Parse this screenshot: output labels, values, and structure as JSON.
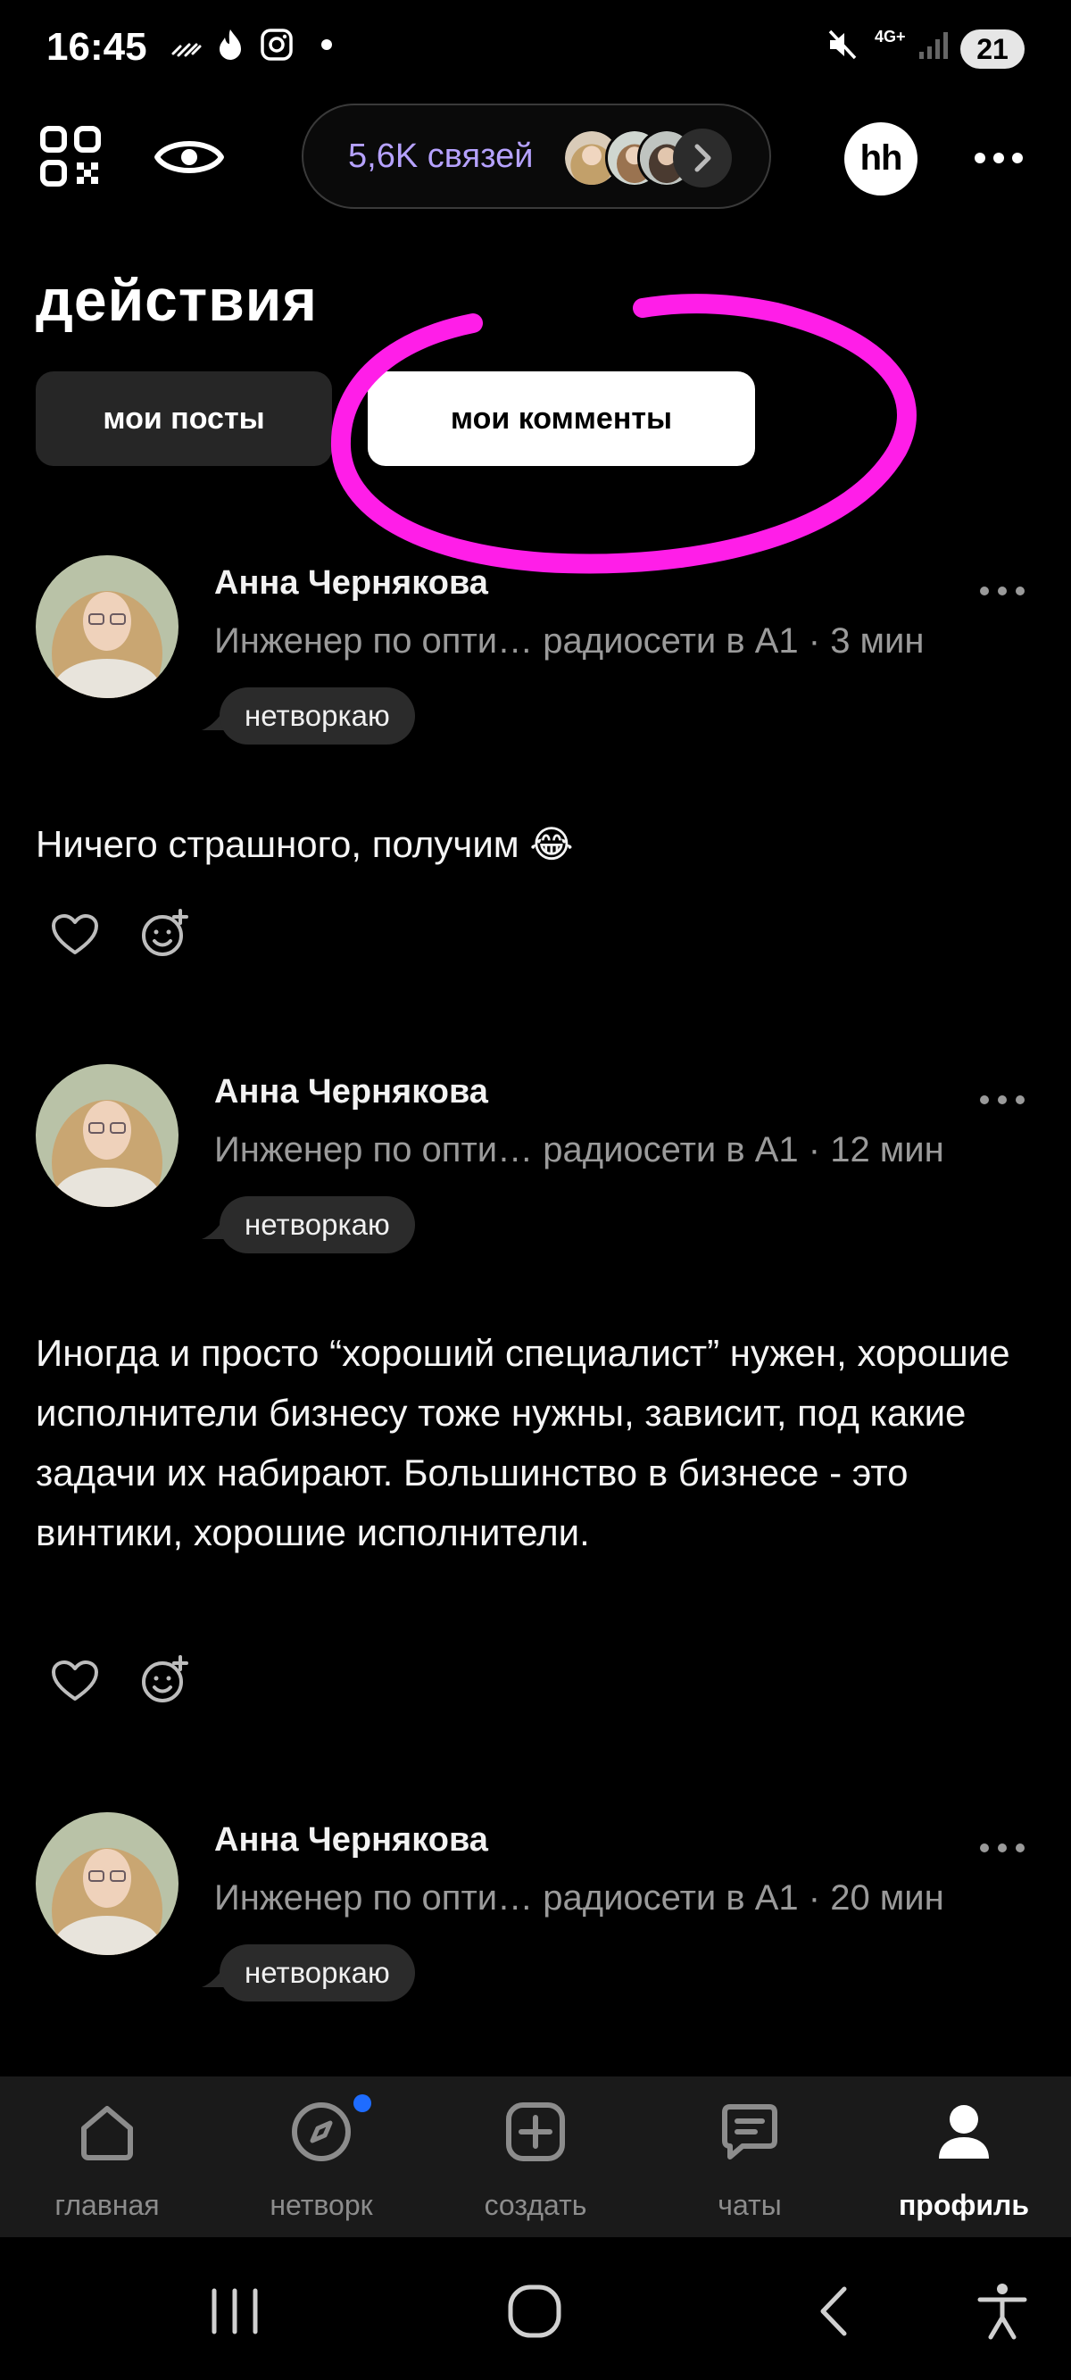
{
  "status_bar": {
    "time": "16:45",
    "network": "4G+",
    "battery": "21",
    "icons": [
      "wifi-calling-icon",
      "fire-icon",
      "instagram-icon",
      "dot-icon",
      "mute-icon",
      "signal-icon"
    ]
  },
  "header": {
    "connections_label": "5,6K связей",
    "logo": "hh",
    "icons": [
      "qr-code-icon",
      "eye-icon",
      "chevron-right-icon",
      "more-icon"
    ]
  },
  "page": {
    "title": "действия",
    "tabs": [
      {
        "label": "мои посты",
        "active": false
      },
      {
        "label": "мои комменты",
        "active": true
      }
    ]
  },
  "comments": [
    {
      "author": "Анна Чернякова",
      "meta": "Инженер по опти… радиосети в А1 · 3 мин",
      "tag": "нетворкаю",
      "text": "Ничего страшного, получим 😂"
    },
    {
      "author": "Анна Чернякова",
      "meta": "Инженер по опти… радиосети в А1 · 12 мин",
      "tag": "нетворкаю",
      "text": "Иногда и просто “хороший специалист” нужен, хорошие исполнители бизнесу тоже нужны, зависит, под какие задачи их набирают. Большинство в бизнесе - это винтики, хорошие исполнители."
    },
    {
      "author": "Анна Чернякова",
      "meta": "Инженер по опти… радиосети в А1 · 20 мин",
      "tag": "нетворкаю",
      "text": ""
    }
  ],
  "bottom_nav": [
    {
      "label": "главная",
      "icon": "home-icon",
      "active": false
    },
    {
      "label": "нетворк",
      "icon": "compass-icon",
      "active": false,
      "badge": true
    },
    {
      "label": "создать",
      "icon": "plus-square-icon",
      "active": false
    },
    {
      "label": "чаты",
      "icon": "chat-icon",
      "active": false
    },
    {
      "label": "профиль",
      "icon": "profile-icon",
      "active": true
    }
  ],
  "system_nav": [
    "recents-icon",
    "home-circle-icon",
    "back-icon",
    "accessibility-icon"
  ],
  "colors": {
    "background": "#000000",
    "accent_text": "#b6a2ff",
    "highlight": "#ff1ee8",
    "badge": "#1e6cff"
  }
}
